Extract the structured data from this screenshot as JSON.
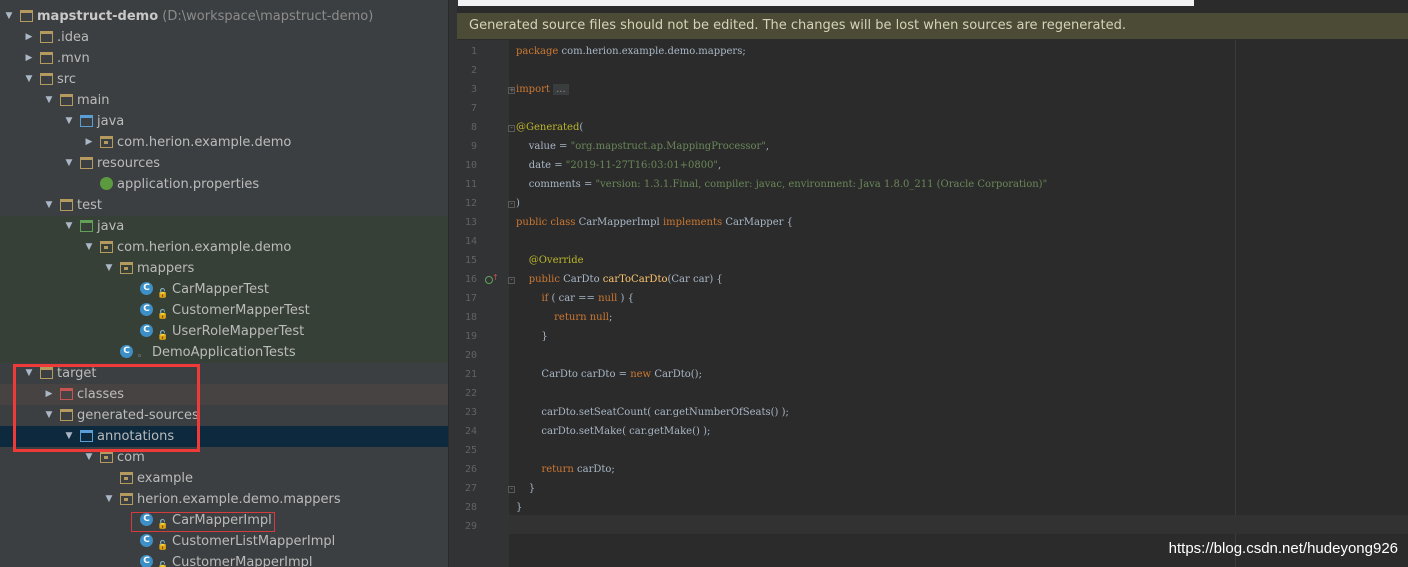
{
  "project": {
    "name": "mapstruct-demo",
    "path": "(D:\\workspace\\mapstruct-demo)"
  },
  "tree": [
    {
      "label": "mapstruct-demo",
      "type": "project",
      "indent": 0,
      "expanded": true
    },
    {
      "label": ".idea",
      "type": "folder",
      "indent": 1,
      "expanded": false
    },
    {
      "label": ".mvn",
      "type": "folder",
      "indent": 1,
      "expanded": false
    },
    {
      "label": "src",
      "type": "folder",
      "indent": 1,
      "expanded": true
    },
    {
      "label": "main",
      "type": "folder",
      "indent": 2,
      "expanded": true
    },
    {
      "label": "java",
      "type": "folder-blue",
      "indent": 3,
      "expanded": true
    },
    {
      "label": "com.herion.example.demo",
      "type": "package",
      "indent": 4,
      "expanded": false
    },
    {
      "label": "resources",
      "type": "folder-res",
      "indent": 3,
      "expanded": true
    },
    {
      "label": "application.properties",
      "type": "properties",
      "indent": 4
    },
    {
      "label": "test",
      "type": "folder",
      "indent": 2,
      "expanded": true
    },
    {
      "label": "java",
      "type": "folder-green",
      "indent": 3,
      "expanded": true,
      "zone": "test"
    },
    {
      "label": "com.herion.example.demo",
      "type": "package",
      "indent": 4,
      "expanded": true,
      "zone": "test"
    },
    {
      "label": "mappers",
      "type": "package",
      "indent": 5,
      "expanded": true,
      "zone": "test"
    },
    {
      "label": "CarMapperTest",
      "type": "test-class",
      "indent": 6,
      "zone": "test"
    },
    {
      "label": "CustomerMapperTest",
      "type": "test-class",
      "indent": 6,
      "zone": "test"
    },
    {
      "label": "UserRoleMapperTest",
      "type": "test-class",
      "indent": 6,
      "zone": "test"
    },
    {
      "label": "DemoApplicationTests",
      "type": "class-plain",
      "indent": 5,
      "zone": "test"
    },
    {
      "label": "target",
      "type": "folder",
      "indent": 1,
      "expanded": true
    },
    {
      "label": "classes",
      "type": "folder-red",
      "indent": 2,
      "expanded": false,
      "hl": true
    },
    {
      "label": "generated-sources",
      "type": "folder",
      "indent": 2,
      "expanded": true
    },
    {
      "label": "annotations",
      "type": "folder-blue",
      "indent": 3,
      "expanded": true,
      "selected": true
    },
    {
      "label": "com",
      "type": "package",
      "indent": 4,
      "expanded": true
    },
    {
      "label": "example",
      "type": "package",
      "indent": 5
    },
    {
      "label": "herion.example.demo.mappers",
      "type": "package",
      "indent": 5,
      "expanded": true
    },
    {
      "label": "CarMapperImpl",
      "type": "class",
      "indent": 6
    },
    {
      "label": "CustomerListMapperImpl",
      "type": "class",
      "indent": 6
    },
    {
      "label": "CustomerMapperImpl",
      "type": "class",
      "indent": 6
    }
  ],
  "editor": {
    "banner": "Generated source files should not be edited. The changes will be lost when sources are regenerated.",
    "line_numbers": [
      "1",
      "2",
      "3",
      "7",
      "8",
      "9",
      "10",
      "11",
      "12",
      "13",
      "14",
      "15",
      "16",
      "17",
      "18",
      "19",
      "20",
      "21",
      "22",
      "23",
      "24",
      "25",
      "26",
      "27",
      "28",
      "29"
    ],
    "lines": [
      [
        [
          "kw",
          "package "
        ],
        [
          "",
          "com.herion.example.demo.mappers;"
        ]
      ],
      [],
      [
        [
          "kw",
          "import "
        ],
        [
          "fold",
          "..."
        ]
      ],
      [],
      [
        [
          "ann",
          "@Generated"
        ],
        [
          "",
          "("
        ]
      ],
      [
        [
          "",
          "    value = "
        ],
        [
          "str",
          "\"org.mapstruct.ap.MappingProcessor\""
        ],
        [
          "",
          ","
        ]
      ],
      [
        [
          "",
          "    date = "
        ],
        [
          "str",
          "\"2019-11-27T16:03:01+0800\""
        ],
        [
          "",
          ","
        ]
      ],
      [
        [
          "",
          "    comments = "
        ],
        [
          "str",
          "\"version: 1.3.1.Final, compiler: javac, environment: Java 1.8.0_211 (Oracle Corporation)\""
        ]
      ],
      [
        [
          "",
          ")"
        ]
      ],
      [
        [
          "kw",
          "public class "
        ],
        [
          "",
          "CarMapperImpl "
        ],
        [
          "kw",
          "implements "
        ],
        [
          "",
          "CarMapper {"
        ]
      ],
      [],
      [
        [
          "",
          "    "
        ],
        [
          "ann",
          "@Override"
        ]
      ],
      [
        [
          "",
          "    "
        ],
        [
          "kw",
          "public "
        ],
        [
          "",
          "CarDto "
        ],
        [
          "fn",
          "carToCarDto"
        ],
        [
          "",
          "(Car car) {"
        ]
      ],
      [
        [
          "",
          "        "
        ],
        [
          "kw",
          "if "
        ],
        [
          "",
          "( car == "
        ],
        [
          "kw",
          "null"
        ],
        [
          "",
          " ) {"
        ]
      ],
      [
        [
          "",
          "            "
        ],
        [
          "kw",
          "return null"
        ],
        [
          "",
          ";"
        ]
      ],
      [
        [
          "",
          "        }"
        ]
      ],
      [],
      [
        [
          "",
          "        CarDto carDto = "
        ],
        [
          "kw",
          "new "
        ],
        [
          "",
          "CarDto();"
        ]
      ],
      [],
      [
        [
          "",
          "        carDto.setSeatCount( car.getNumberOfSeats() );"
        ]
      ],
      [
        [
          "",
          "        carDto.setMake( car.getMake() );"
        ]
      ],
      [],
      [
        [
          "",
          "        "
        ],
        [
          "kw",
          "return "
        ],
        [
          "",
          "carDto;"
        ]
      ],
      [
        [
          "",
          "    }"
        ]
      ],
      [
        [
          "",
          "}"
        ]
      ],
      []
    ]
  },
  "watermark": "https://blog.csdn.net/hudeyong926"
}
